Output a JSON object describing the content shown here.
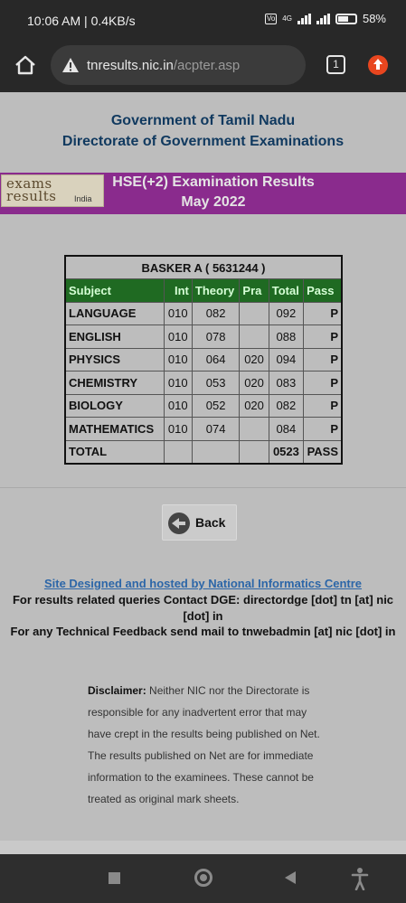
{
  "status_bar": {
    "time_speed": "10:06 AM | 0.4KB/s",
    "network_badge": "4G",
    "battery": "58%"
  },
  "browser": {
    "url_host": "tnresults.nic.in",
    "url_path": "/acpter.asp",
    "tab_count": "1"
  },
  "header": {
    "line1": "Government of Tamil Nadu",
    "line2": "Directorate of Government Examinations"
  },
  "banner": {
    "logo_line1": "exams",
    "logo_line2": "results",
    "logo_line3": "India",
    "title_line1": "HSE(+2)  Examination Results",
    "title_line2": "May 2022"
  },
  "results": {
    "candidate": "BASKER A    ( 5631244 )",
    "columns": [
      "Subject",
      "Int",
      "Theory",
      "Pra",
      "Total",
      "Pass"
    ],
    "rows": [
      {
        "subject": "LANGUAGE",
        "int": "010",
        "theory": "082",
        "pra": "",
        "total": "092",
        "pass": "P"
      },
      {
        "subject": "ENGLISH",
        "int": "010",
        "theory": "078",
        "pra": "",
        "total": "088",
        "pass": "P"
      },
      {
        "subject": "PHYSICS",
        "int": "010",
        "theory": "064",
        "pra": "020",
        "total": "094",
        "pass": "P"
      },
      {
        "subject": "CHEMISTRY",
        "int": "010",
        "theory": "053",
        "pra": "020",
        "total": "083",
        "pass": "P"
      },
      {
        "subject": "BIOLOGY",
        "int": "010",
        "theory": "052",
        "pra": "020",
        "total": "082",
        "pass": "P"
      },
      {
        "subject": "MATHEMATICS",
        "int": "010",
        "theory": "074",
        "pra": "",
        "total": "084",
        "pass": "P"
      },
      {
        "subject": "TOTAL",
        "int": "",
        "theory": "",
        "pra": "",
        "total": "0523",
        "pass": "PASS"
      }
    ]
  },
  "back_button": {
    "label": "Back"
  },
  "footer": {
    "link": "Site Designed and hosted by National Informatics Centre",
    "contact_line1": "For results related queries Contact DGE:  directordge [dot] tn [at] nic",
    "contact_line2": "[dot] in",
    "feedback": "For any Technical Feedback send mail to tnwebadmin [at] nic [dot] in"
  },
  "disclaimer": {
    "label": "Disclaimer:",
    "text": " Neither NIC nor the Directorate is responsible for any inadvertent error that may have crept in the results being published on Net. The results published on Net are for immediate information to the examinees. These cannot be treated as original mark sheets."
  },
  "icons": {
    "home": "home-icon",
    "warning": "warning-icon",
    "tabs": "tabs-icon",
    "update": "update-icon",
    "back": "back-arrow-icon",
    "nav_recent": "recent-apps-icon",
    "nav_home": "nav-home-icon",
    "nav_back": "nav-back-icon",
    "accessibility": "accessibility-icon"
  }
}
